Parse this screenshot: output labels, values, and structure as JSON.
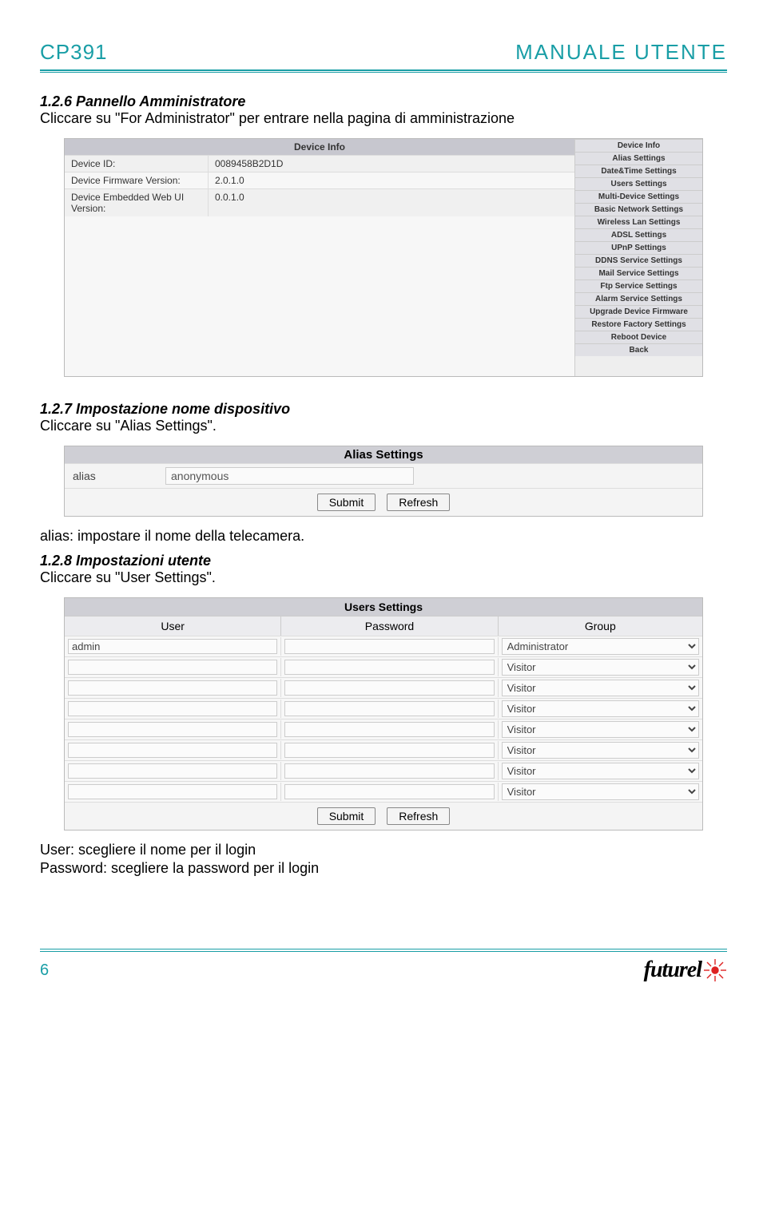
{
  "header": {
    "left": "CP391",
    "right": "MANUALE UTENTE"
  },
  "sec126": {
    "title": "1.2.6 Pannello Amministratore",
    "body": "Cliccare su \"For Administrator\" per entrare nella pagina di amministrazione"
  },
  "shot1": {
    "device_info_title": "Device Info",
    "rows": [
      {
        "label": "Device ID:",
        "value": "0089458B2D1D"
      },
      {
        "label": "Device Firmware Version:",
        "value": "2.0.1.0"
      },
      {
        "label": "Device Embedded Web UI Version:",
        "value": "0.0.1.0"
      }
    ],
    "menu": [
      "Device Info",
      "Alias Settings",
      "Date&Time Settings",
      "Users Settings",
      "Multi-Device Settings",
      "Basic Network Settings",
      "Wireless Lan Settings",
      "ADSL Settings",
      "UPnP Settings",
      "DDNS Service Settings",
      "Mail Service Settings",
      "Ftp Service Settings",
      "Alarm Service Settings",
      "Upgrade Device Firmware",
      "Restore Factory Settings",
      "Reboot Device",
      "Back"
    ]
  },
  "sec127": {
    "title": "1.2.7 Impostazione nome dispositivo",
    "body": "Cliccare su \"Alias Settings\".",
    "after": "alias: impostare il nome della telecamera."
  },
  "shot2": {
    "title": "Alias Settings",
    "label": "alias",
    "value": "anonymous",
    "submit": "Submit",
    "refresh": "Refresh"
  },
  "sec128": {
    "title": "1.2.8 Impostazioni utente",
    "body": "Cliccare su \"User Settings\"."
  },
  "shot3": {
    "title": "Users Settings",
    "col_user": "User",
    "col_pass": "Password",
    "col_group": "Group",
    "rows": [
      {
        "user": "admin",
        "pass": "",
        "group": "Administrator"
      },
      {
        "user": "",
        "pass": "",
        "group": "Visitor"
      },
      {
        "user": "",
        "pass": "",
        "group": "Visitor"
      },
      {
        "user": "",
        "pass": "",
        "group": "Visitor"
      },
      {
        "user": "",
        "pass": "",
        "group": "Visitor"
      },
      {
        "user": "",
        "pass": "",
        "group": "Visitor"
      },
      {
        "user": "",
        "pass": "",
        "group": "Visitor"
      },
      {
        "user": "",
        "pass": "",
        "group": "Visitor"
      }
    ],
    "submit": "Submit",
    "refresh": "Refresh"
  },
  "after_users": {
    "line1": "User: scegliere il nome per il login",
    "line2": "Password: scegliere la password per il login"
  },
  "footer": {
    "page": "6",
    "logo": "futurel"
  }
}
